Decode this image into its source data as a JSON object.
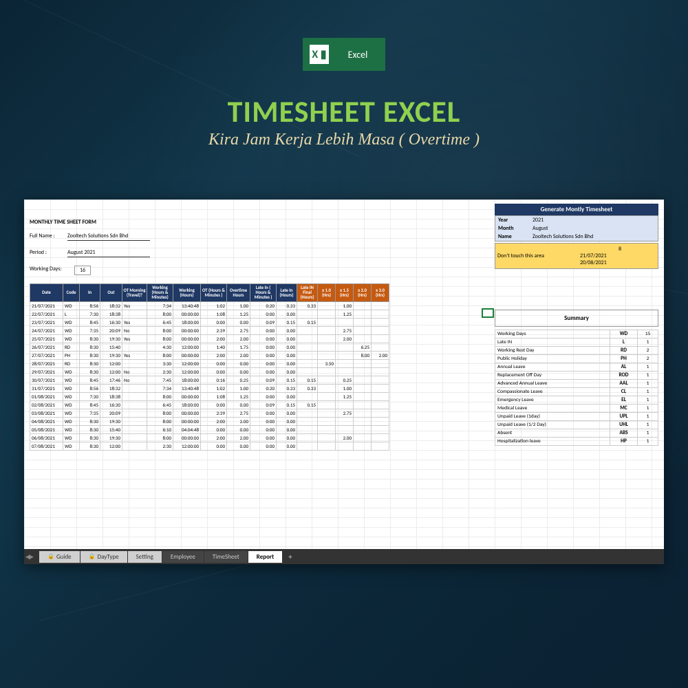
{
  "badge_label": "Excel",
  "title": "TIMESHEET EXCEL",
  "subtitle": "Kira Jam Kerja Lebih Masa ( Overtime )",
  "form": {
    "title": "MONTHLY TIME SHEET FORM",
    "full_name_label": "Full Name :",
    "full_name": "Zooltech Solutions Sdn Bhd",
    "period_label": "Period :",
    "period": "August 2021",
    "working_days_label": "Working Days:",
    "working_days": "16"
  },
  "headers": {
    "date": "Date",
    "code": "Code",
    "in": "In",
    "out": "Out",
    "ot_morning": "OT Morning (Travel)?",
    "working_hm": "Working (Hours & Minutes)",
    "working_h": "Working (Hours)",
    "ot_hm": "OT (Hours & Minutes )",
    "overtime_h": "Overtime Hours",
    "latein_hm": "Late In ( Hours & Minutes )",
    "latein_h": "Late In (Hours)",
    "latein_final": "Late IN Final (Hours)",
    "x10": "x 1.0 (Hrs)",
    "x15": "x 1.5 (Hrs)",
    "x20": "x 2.0 (Hrs)",
    "x30": "x 3.0 (Hrs)"
  },
  "rows": [
    {
      "date": "21/07/2021",
      "code": "WD",
      "in": "8:56",
      "out": "18:32",
      "otm": "Yes",
      "whm": "7:34",
      "wh": "13:40:48",
      "othm": "1:02",
      "oth": "1.00",
      "lihm": "0:20",
      "lih": "0.33",
      "lif": "0.33",
      "x10": "",
      "x15": "1.00",
      "x20": "",
      "x30": ""
    },
    {
      "date": "22/07/2021",
      "code": "L",
      "in": "7:30",
      "out": "18:38",
      "otm": "",
      "whm": "8:00",
      "wh": "00:00:00",
      "othm": "1:08",
      "oth": "1.25",
      "lihm": "0:00",
      "lih": "0.00",
      "lif": "",
      "x10": "",
      "x15": "1.25",
      "x20": "",
      "x30": ""
    },
    {
      "date": "23/07/2021",
      "code": "WD",
      "in": "8:45",
      "out": "16:30",
      "otm": "Yes",
      "whm": "6:45",
      "wh": "18:00:00",
      "othm": "0:00",
      "oth": "0.00",
      "lihm": "0:09",
      "lih": "0.15",
      "lif": "0.15",
      "x10": "",
      "x15": "",
      "x20": "",
      "x30": ""
    },
    {
      "date": "24/07/2021",
      "code": "WD",
      "in": "7:35",
      "out": "20:09",
      "otm": "No",
      "whm": "8:00",
      "wh": "00:00:00",
      "othm": "2:39",
      "oth": "2.75",
      "lihm": "0:00",
      "lih": "0.00",
      "lif": "",
      "x10": "",
      "x15": "2.75",
      "x20": "",
      "x30": ""
    },
    {
      "date": "25/07/2021",
      "code": "WD",
      "in": "8:30",
      "out": "19:30",
      "otm": "Yes",
      "whm": "8:00",
      "wh": "00:00:00",
      "othm": "2:00",
      "oth": "2.00",
      "lihm": "0:00",
      "lih": "0.00",
      "lif": "",
      "x10": "",
      "x15": "2.00",
      "x20": "",
      "x30": ""
    },
    {
      "date": "26/07/2021",
      "code": "RD",
      "in": "8:30",
      "out": "15:40",
      "otm": "",
      "whm": "4:30",
      "wh": "12:00:00",
      "othm": "1:40",
      "oth": "1.75",
      "lihm": "0:00",
      "lih": "0.00",
      "lif": "",
      "x10": "",
      "x15": "",
      "x20": "6.25",
      "x30": ""
    },
    {
      "date": "27/07/2021",
      "code": "PH",
      "in": "8:30",
      "out": "19:30",
      "otm": "Yes",
      "whm": "8:00",
      "wh": "00:00:00",
      "othm": "2:00",
      "oth": "2.00",
      "lihm": "0:00",
      "lih": "0.00",
      "lif": "",
      "x10": "",
      "x15": "",
      "x20": "8.00",
      "x30": "2.00"
    },
    {
      "date": "28/07/2021",
      "code": "RD",
      "in": "8:30",
      "out": "12:00",
      "otm": "",
      "whm": "3:30",
      "wh": "12:00:00",
      "othm": "0:00",
      "oth": "0.00",
      "lihm": "0:00",
      "lih": "0.00",
      "lif": "",
      "x10": "3.50",
      "x15": "",
      "x20": "",
      "x30": ""
    },
    {
      "date": "29/07/2021",
      "code": "WD",
      "in": "8:30",
      "out": "12:00",
      "otm": "No",
      "whm": "2:30",
      "wh": "12:00:00",
      "othm": "0:00",
      "oth": "0.00",
      "lihm": "0:00",
      "lih": "0.00",
      "lif": "",
      "x10": "",
      "x15": "",
      "x20": "",
      "x30": ""
    },
    {
      "date": "30/07/2021",
      "code": "WD",
      "in": "8:45",
      "out": "17:46",
      "otm": "No",
      "whm": "7:45",
      "wh": "18:00:00",
      "othm": "0:16",
      "oth": "0.25",
      "lihm": "0:09",
      "lih": "0.15",
      "lif": "0.15",
      "x10": "",
      "x15": "0.25",
      "x20": "",
      "x30": ""
    },
    {
      "date": "31/07/2021",
      "code": "WD",
      "in": "8:56",
      "out": "18:32",
      "otm": "",
      "whm": "7:34",
      "wh": "13:40:48",
      "othm": "1:02",
      "oth": "1.00",
      "lihm": "0:20",
      "lih": "0.33",
      "lif": "0.33",
      "x10": "",
      "x15": "1.00",
      "x20": "",
      "x30": ""
    },
    {
      "date": "01/08/2021",
      "code": "WD",
      "in": "7:30",
      "out": "18:38",
      "otm": "",
      "whm": "8:00",
      "wh": "00:00:00",
      "othm": "1:08",
      "oth": "1.25",
      "lihm": "0:00",
      "lih": "0.00",
      "lif": "",
      "x10": "",
      "x15": "1.25",
      "x20": "",
      "x30": ""
    },
    {
      "date": "02/08/2021",
      "code": "WD",
      "in": "8:45",
      "out": "16:30",
      "otm": "",
      "whm": "6:45",
      "wh": "18:00:00",
      "othm": "0:00",
      "oth": "0.00",
      "lihm": "0:09",
      "lih": "0.15",
      "lif": "0.15",
      "x10": "",
      "x15": "",
      "x20": "",
      "x30": ""
    },
    {
      "date": "03/08/2021",
      "code": "WD",
      "in": "7:35",
      "out": "20:09",
      "otm": "",
      "whm": "8:00",
      "wh": "00:00:00",
      "othm": "2:39",
      "oth": "2.75",
      "lihm": "0:00",
      "lih": "0.00",
      "lif": "",
      "x10": "",
      "x15": "2.75",
      "x20": "",
      "x30": ""
    },
    {
      "date": "04/08/2021",
      "code": "WD",
      "in": "8:30",
      "out": "19:30",
      "otm": "",
      "whm": "8:00",
      "wh": "00:00:00",
      "othm": "2:00",
      "oth": "2.00",
      "lihm": "0:00",
      "lih": "0.00",
      "lif": "",
      "x10": "",
      "x15": "",
      "x20": "",
      "x30": ""
    },
    {
      "date": "05/08/2021",
      "code": "WD",
      "in": "8:30",
      "out": "15:40",
      "otm": "",
      "whm": "6:10",
      "wh": "04:04:48",
      "othm": "0:00",
      "oth": "0.00",
      "lihm": "0:00",
      "lih": "0.00",
      "lif": "",
      "x10": "",
      "x15": "",
      "x20": "",
      "x30": ""
    },
    {
      "date": "06/08/2021",
      "code": "WD",
      "in": "8:30",
      "out": "19:30",
      "otm": "",
      "whm": "8:00",
      "wh": "00:00:00",
      "othm": "2:00",
      "oth": "2.00",
      "lihm": "0:00",
      "lih": "0.00",
      "lif": "",
      "x10": "",
      "x15": "2.00",
      "x20": "",
      "x30": ""
    },
    {
      "date": "07/08/2021",
      "code": "WD",
      "in": "8:30",
      "out": "12:00",
      "otm": "",
      "whm": "2:30",
      "wh": "12:00:00",
      "othm": "0:00",
      "oth": "0.00",
      "lihm": "0:00",
      "lih": "0.00",
      "lif": "",
      "x10": "",
      "x15": "",
      "x20": "",
      "x30": ""
    }
  ],
  "gen": {
    "title": "Generate Montly Timesheet",
    "year_label": "Year",
    "year": "2021",
    "month_label": "Month",
    "month": "August",
    "name_label": "Name",
    "name": "Zooltech Solutions Sdn Bhd"
  },
  "yellow": {
    "num": "8",
    "warn": "Don't touch this area",
    "d1": "21/07/2021",
    "d2": "20/08/2021"
  },
  "summary": {
    "title": "Summary",
    "items": [
      {
        "label": "Working Days",
        "code": "WD",
        "val": "15"
      },
      {
        "label": "Late IN",
        "code": "L",
        "val": "1"
      },
      {
        "label": "Working Rest Day",
        "code": "RD",
        "val": "2"
      },
      {
        "label": "Public Holiday",
        "code": "PH",
        "val": "2"
      },
      {
        "label": "Annual Leave",
        "code": "AL",
        "val": "1"
      },
      {
        "label": "Replacement Off Day",
        "code": "ROD",
        "val": "1"
      },
      {
        "label": "Advanced Annual Leave",
        "code": "AAL",
        "val": "1"
      },
      {
        "label": "Compassionate Leave",
        "code": "CL",
        "val": "1"
      },
      {
        "label": "Emergency Leave",
        "code": "EL",
        "val": "1"
      },
      {
        "label": "Medical Leave",
        "code": "MC",
        "val": "1"
      },
      {
        "label": "Unpaid Leave (1day)",
        "code": "UPL",
        "val": "1"
      },
      {
        "label": "Unpaid Leave (1/2 Day)",
        "code": "UHL",
        "val": "1"
      },
      {
        "label": "Absent",
        "code": "ABS",
        "val": "1"
      },
      {
        "label": "Hospitalization leave",
        "code": "HP",
        "val": "1"
      }
    ]
  },
  "tabs": {
    "guide": "Guide",
    "daytype": "DayType",
    "setting": "Setting",
    "employee": "Employee",
    "timesheet": "TimeSheet",
    "report": "Report",
    "add": "+"
  }
}
